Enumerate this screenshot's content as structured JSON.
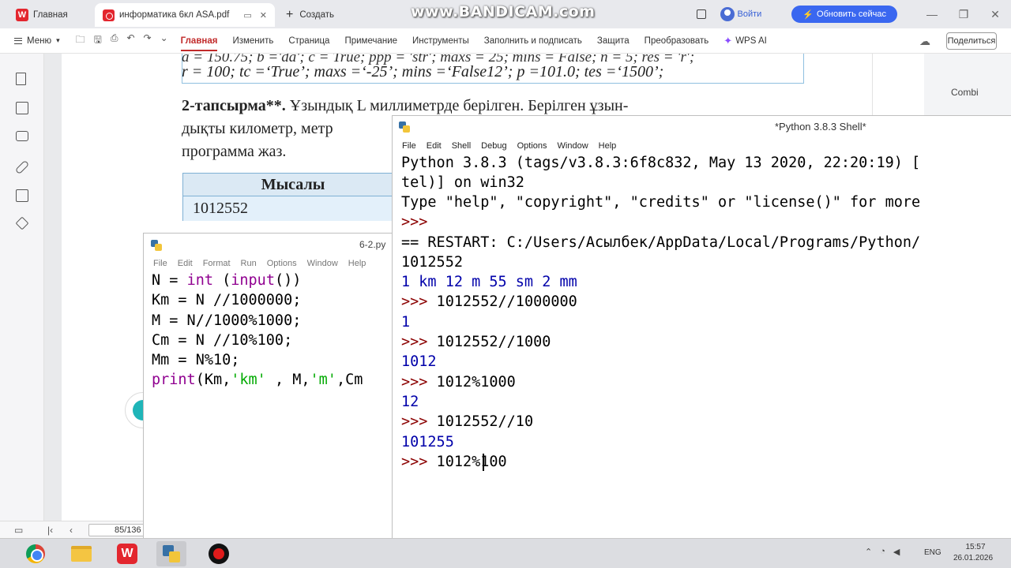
{
  "watermark": "www.BANDICAM.com",
  "wps": {
    "tabs": [
      {
        "label": "Главная"
      },
      {
        "label": "информатика 6кл ASA.pdf"
      },
      {
        "label": "Создать"
      }
    ],
    "login_label": "Войти",
    "upgrade_label": "Обновить сейчас",
    "menu_label": "Меню",
    "ribbon_tabs": [
      "Главная",
      "Изменить",
      "Страница",
      "Примечание",
      "Инструменты",
      "Заполнить и подписать",
      "Защита",
      "Преобразовать"
    ],
    "wps_ai_label": "WPS AI",
    "share_label": "Поделиться",
    "side_tool_label": "Combi",
    "page_indicator": "85/136",
    "accent_color": "#c12a2a"
  },
  "document": {
    "prev_line_cut": "a = 150.75; b ='da'; c = True; ppp = 'str'; maxs = 25; mins = False; n = 5; res = 'r';",
    "prev_line": "r = 100; tc =‘True’; maxs =‘-25’; mins =‘False12’; p =101.0; tes =‘1500’;",
    "task_bold": "2-тапсырма**.",
    "task_line1_rest": " Ұзындық L миллиметрде берілген. Берілген ұзын-",
    "task_line2": "дықты километр, метр",
    "task_line3": "программа жаз.",
    "example_header": "Мысалы",
    "example_value": "1012552"
  },
  "editor": {
    "title": "6-2.py",
    "menu": [
      "File",
      "Edit",
      "Format",
      "Run",
      "Options",
      "Window",
      "Help"
    ]
  },
  "shell": {
    "title": "*Python 3.8.3 Shell*",
    "menu": [
      "File",
      "Edit",
      "Shell",
      "Debug",
      "Options",
      "Window",
      "Help"
    ],
    "banner1": "Python 3.8.3 (tags/v3.8.3:6f8c832, May 13 2020, 22:20:19) [",
    "banner2": "tel)] on win32",
    "banner3": "Type \"help\", \"copyright\", \"credits\" or \"license()\" for more",
    "prompt": ">>>",
    "restart": "== RESTART: C:/Users/Асылбек/AppData/Local/Programs/Python/",
    "input_echo": "1012552",
    "run_output": "1 km 12 m 55 sm 2 mm",
    "cmd1": " 1012552//1000000",
    "out1": "1",
    "cmd2": " 1012552//1000",
    "out2": "1012",
    "cmd3": " 1012%1000",
    "out3": "12",
    "cmd4": " 1012552//10",
    "out4": "101255",
    "cmd5": " 1012%100"
  },
  "taskbar": {
    "lang": "ENG",
    "time": "15:57",
    "date": "26.01.2026"
  }
}
